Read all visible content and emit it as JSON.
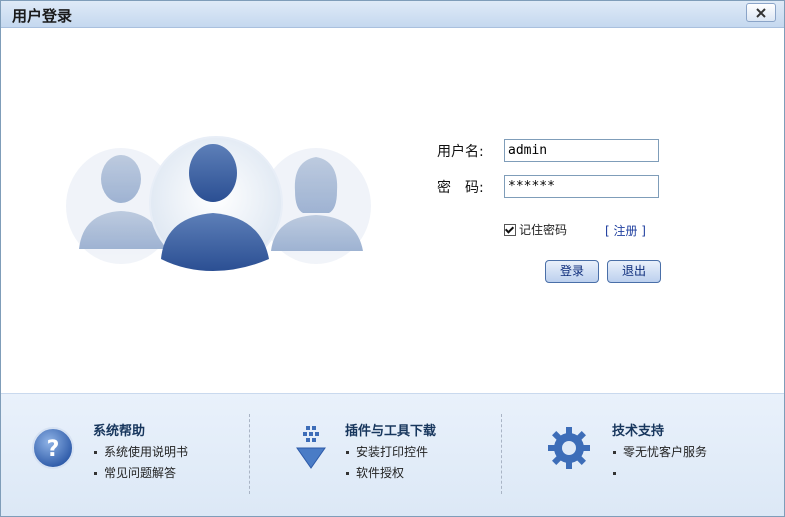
{
  "window": {
    "title": "用户登录"
  },
  "form": {
    "username_label": "用户名:",
    "username_value": "admin",
    "password_label": "密　码:",
    "password_value": "******",
    "remember_label": "记住密码",
    "register_link": "[ 注册 ]",
    "login_button": "登录",
    "exit_button": "退出"
  },
  "footer": {
    "sections": [
      {
        "title": "系统帮助",
        "icon": "help-icon",
        "items": [
          "系统使用说明书",
          "常见问题解答"
        ]
      },
      {
        "title": "插件与工具下载",
        "icon": "download-icon",
        "items": [
          "安装打印控件",
          "软件授权"
        ]
      },
      {
        "title": "技术支持",
        "icon": "gear-icon",
        "items": [
          "零无忧客户服务",
          ""
        ]
      }
    ]
  },
  "colors": {
    "accent": "#1f3f9f",
    "title_bar": "#c5d8ef",
    "footer_bg": "#e3edf9"
  }
}
